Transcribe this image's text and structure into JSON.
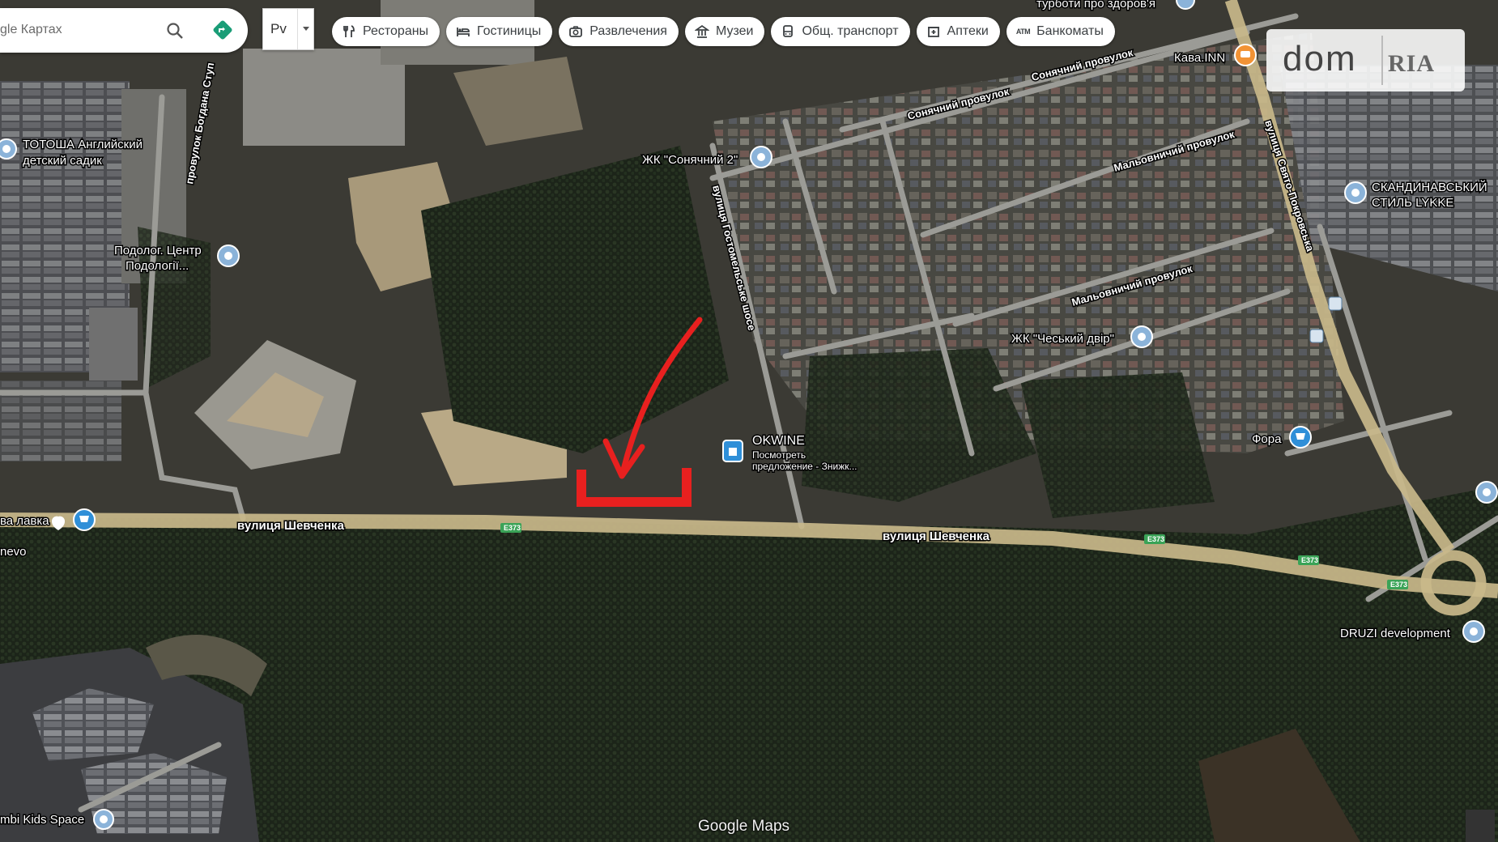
{
  "search": {
    "query": "gle Картах"
  },
  "layer_toggle": {
    "label": "Рv"
  },
  "chips": [
    {
      "icon": "restaurant-icon",
      "label": "Рестораны"
    },
    {
      "icon": "hotel-icon",
      "label": "Гостиницы"
    },
    {
      "icon": "camera-icon",
      "label": "Развлечения"
    },
    {
      "icon": "museum-icon",
      "label": "Музеи"
    },
    {
      "icon": "bus-icon",
      "label": "Общ. транспорт"
    },
    {
      "icon": "pharmacy-icon",
      "label": "Аптеки"
    },
    {
      "icon": "atm-icon",
      "label": "Банкоматы"
    }
  ],
  "watermark": {
    "left": "dom",
    "right": "RIA"
  },
  "roads": {
    "main": "вулиця Шевченка",
    "route_code": "E373",
    "gostomelske": "вулиця Гостомельське шосе",
    "svyato": "вулиця Свято-Покровська",
    "bogdana": "провулок Богдана Ступ",
    "sonyachnyi": "Сонячний провулок",
    "malovnychyi": "Мальовничий провулок"
  },
  "places": {
    "turboty": "турботи про здоров'я",
    "kava_inn": "Кава.INN",
    "totosha_1": "ТОТОША Английский",
    "totosha_2": "детский садик",
    "sonyachnyi2": "ЖК \"Сонячний 2\"",
    "skandinav_1": "СКАНДИНАВСЬКИЙ",
    "skandinav_2": "СТИЛЬ LYKKE",
    "podolog_1": "Подолог. Центр",
    "podolog_2": "Подології...",
    "cheskyi": "ЖК \"Чеський двір\"",
    "okwine": "OKWINE",
    "okwine_1": "Посмотреть",
    "okwine_2": "предложение - Знижк...",
    "fora": "Фора",
    "lavka": "ва лавка",
    "nevo": "nevo",
    "druzi": "DRUZI development",
    "kids": "mbi Kids Space"
  },
  "attribution": "Google Maps",
  "colors": {
    "road": "#c9b98a",
    "route_badge": "#3aa357",
    "annotation": "#e8201f",
    "shop_pin": "#2f8fd8",
    "food_pin": "#f29335"
  }
}
